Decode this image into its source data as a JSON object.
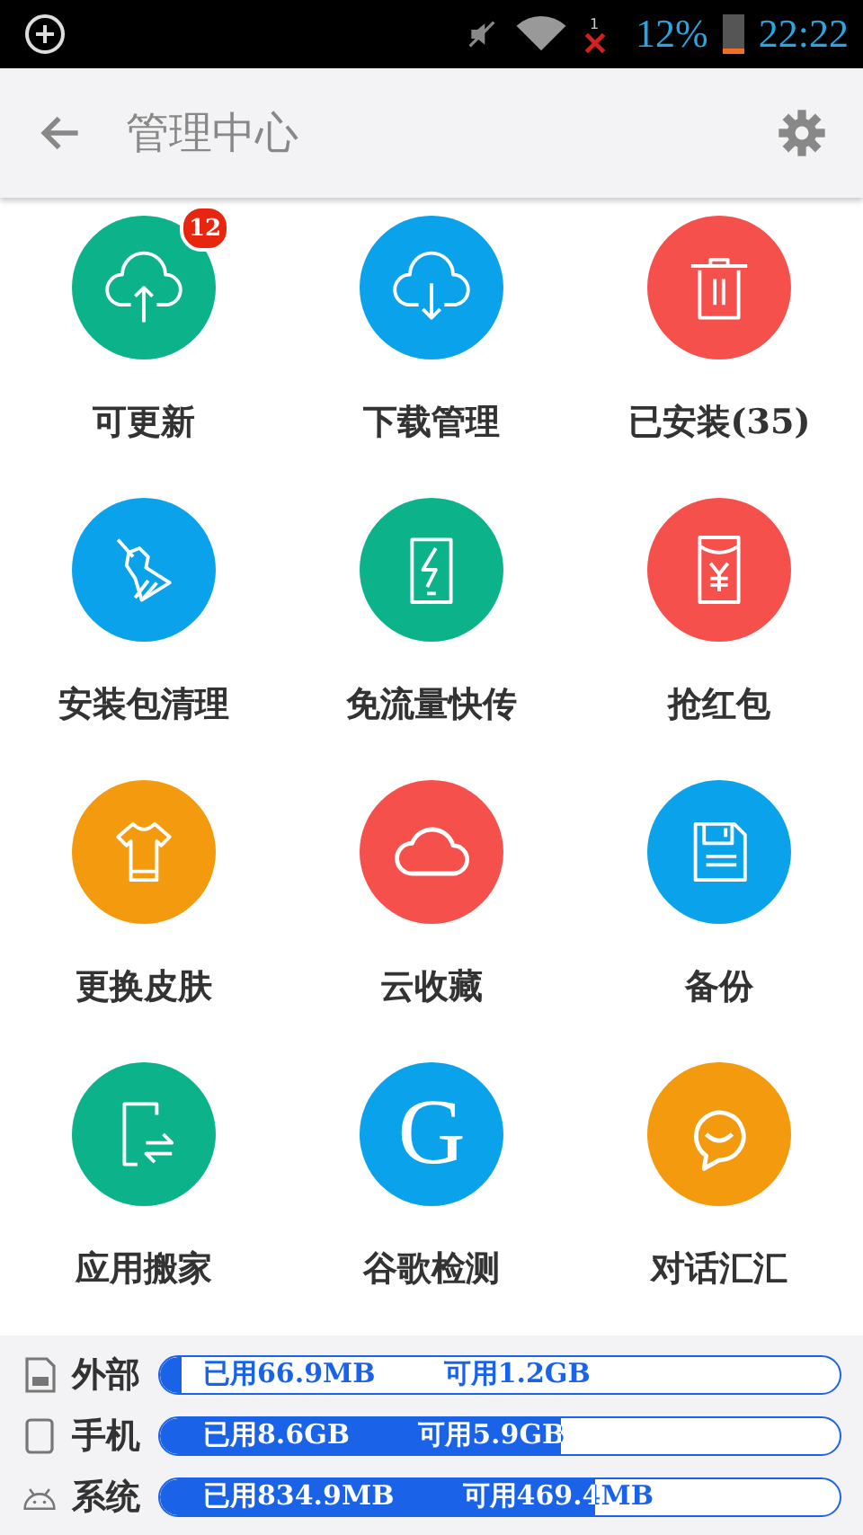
{
  "status_bar": {
    "signal_badge": "1",
    "battery_percent": "12%",
    "time": "22:22"
  },
  "header": {
    "title": "管理中心"
  },
  "tools": [
    {
      "label": "可更新",
      "color": "#0cb38a",
      "badge": "12"
    },
    {
      "label": "下载管理",
      "color": "#0aa2ea"
    },
    {
      "label": "已安装(35)",
      "color": "#f5504c"
    },
    {
      "label": "安装包清理",
      "color": "#0aa2ea"
    },
    {
      "label": "免流量快传",
      "color": "#0cb38a"
    },
    {
      "label": "抢红包",
      "color": "#f5504c"
    },
    {
      "label": "更换皮肤",
      "color": "#f39a0e"
    },
    {
      "label": "云收藏",
      "color": "#f5504c"
    },
    {
      "label": "备份",
      "color": "#0aa2ea"
    },
    {
      "label": "应用搬家",
      "color": "#0cb38a"
    },
    {
      "label": "谷歌检测",
      "glyph": "G",
      "color": "#0aa2ea"
    },
    {
      "label": "对话汇汇",
      "color": "#f39a0e"
    }
  ],
  "storage": [
    {
      "kind": "sd",
      "name": "外部",
      "used": "已用66.9MB",
      "free": "可用1.2GB",
      "level": 0.03
    },
    {
      "kind": "phone",
      "name": "手机",
      "used": "已用8.6GB",
      "free": "可用5.9GB",
      "level": 0.59
    },
    {
      "kind": "system",
      "name": "系统",
      "used": "已用834.9MB",
      "free": "可用469.4MB",
      "level": 0.64
    }
  ]
}
